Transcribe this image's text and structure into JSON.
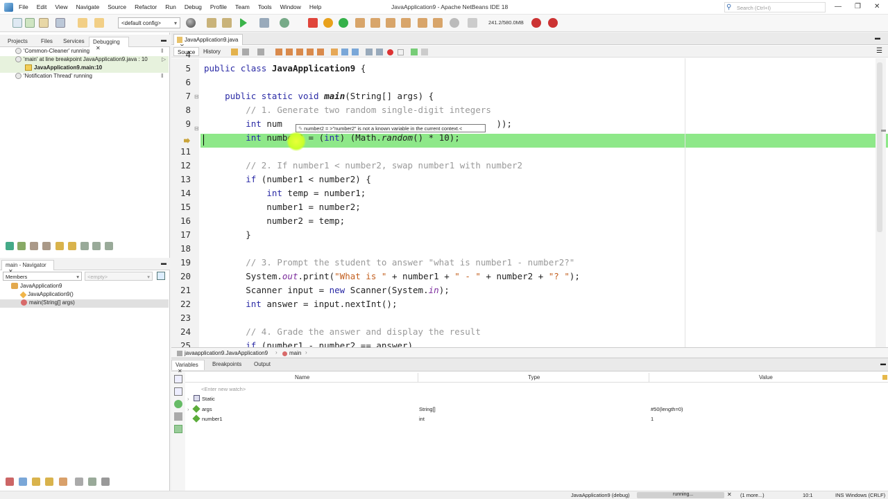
{
  "window": {
    "title": "JavaApplication9 - Apache NetBeans IDE 18",
    "search_placeholder": "Search (Ctrl+I)"
  },
  "menu": [
    "File",
    "Edit",
    "View",
    "Navigate",
    "Source",
    "Refactor",
    "Run",
    "Debug",
    "Profile",
    "Team",
    "Tools",
    "Window",
    "Help"
  ],
  "toolbar": {
    "config": "<default config>",
    "memory": "241.2/580.0MB"
  },
  "debug_panel": {
    "tabs": [
      "Projects",
      "Files",
      "Services",
      "Debugging"
    ],
    "threads": [
      "'Common-Cleaner' running",
      "'main' at line breakpoint JavaApplication9.java : 10",
      "JavaApplication9.main:10",
      "'Notification Thread' running"
    ]
  },
  "navigator": {
    "title": "main - Navigator",
    "filter": "Members",
    "filter2": "<empty>",
    "items": [
      "JavaApplication9",
      "JavaApplication9()",
      "main(String[] args)"
    ]
  },
  "editor": {
    "file_tab": "JavaApplication9.java",
    "source_tab": "Source",
    "history_tab": "History",
    "line_numbers": [
      "4",
      "5",
      "6",
      "7",
      "8",
      "9",
      "10",
      "11",
      "12",
      "13",
      "14",
      "15",
      "16",
      "17",
      "18",
      "19",
      "20",
      "21",
      "22",
      "23",
      "24",
      "25"
    ],
    "tooltip": "number2 = >\"number2\" is not a known variable in the current context.<",
    "breadcrumb1": "javaapplication9.JavaApplication9",
    "breadcrumb2": "main"
  },
  "bottom": {
    "tabs": [
      "Variables",
      "Breakpoints",
      "Output"
    ],
    "headers": {
      "name": "Name",
      "type": "Type",
      "value": "Value"
    },
    "watch_placeholder": "<Enter new watch>",
    "vars": [
      {
        "name": "Static",
        "type": "",
        "value": ""
      },
      {
        "name": "args",
        "type": "String[]",
        "value": "#50(length=0)"
      },
      {
        "name": "number1",
        "type": "int",
        "value": "1"
      }
    ]
  },
  "status": {
    "session": "JavaApplication9 (debug)",
    "progress": "running...",
    "more": "(1 more...)",
    "position": "10:1",
    "mode": "INS",
    "eol": "Windows (CRLF)"
  },
  "colors": {
    "highlight": "#8ee889",
    "keyword": "#2a2aa5",
    "comment": "#999999",
    "string": "#c35f1e"
  }
}
